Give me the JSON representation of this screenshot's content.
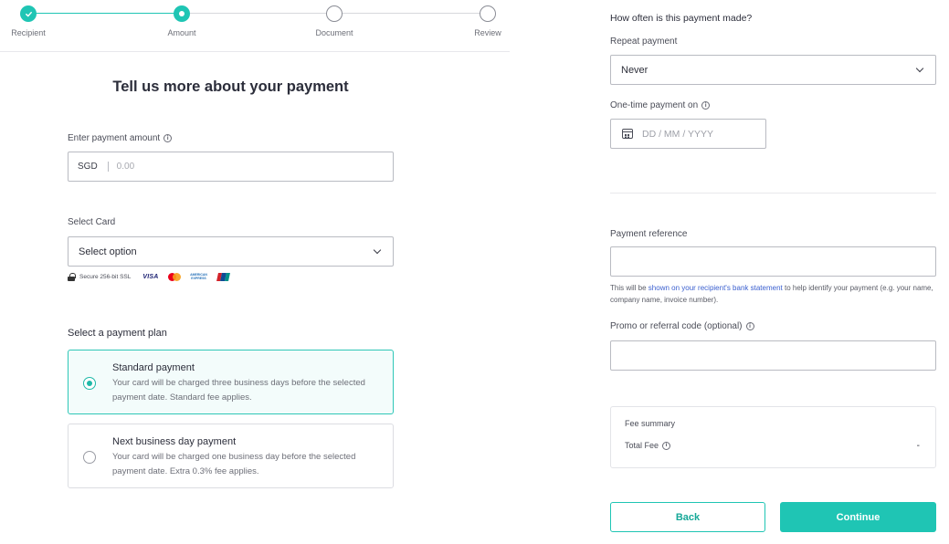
{
  "stepper": {
    "steps": [
      {
        "label": "Recipient",
        "state": "done"
      },
      {
        "label": "Amount",
        "state": "current"
      },
      {
        "label": "Document",
        "state": "todo"
      },
      {
        "label": "Review",
        "state": "todo"
      }
    ]
  },
  "colors": {
    "accent": "#1fc5b4",
    "link": "#3a5fcf"
  },
  "form": {
    "title": "Tell us more about your payment",
    "amount_label": "Enter payment amount",
    "currency": "SGD",
    "amount_placeholder": "0.00",
    "card_label": "Select Card",
    "card_value": "Select option",
    "secure_text": "Secure 256-bit SSL",
    "card_brands": [
      "VISA",
      "Mastercard",
      "AMERICAN EXPRESS",
      "UnionPay"
    ],
    "visa_text": "VISA",
    "amex_text": "AMERICAN EXPRESS",
    "plan_label": "Select a payment plan",
    "plans": [
      {
        "name": "Standard payment",
        "desc": "Your card will be charged three business days before the selected payment date. Standard fee applies.",
        "selected": true
      },
      {
        "name": "Next business day payment",
        "desc": "Your card will be charged one business day before the selected payment date. Extra 0.3% fee applies.",
        "selected": false
      }
    ]
  },
  "schedule": {
    "title": "How often is this payment made?",
    "repeat_label": "Repeat payment",
    "repeat_value": "Never",
    "date_label": "One-time payment on",
    "date_placeholder": "DD / MM / YYYY"
  },
  "reference": {
    "label": "Payment reference",
    "value": "",
    "helper_before": "This will be ",
    "helper_link": "shown on your recipient's bank statement",
    "helper_after": " to help identify your payment (e.g. your name, company name, invoice number)."
  },
  "promo": {
    "label": "Promo or referral code (optional)",
    "value": ""
  },
  "fees": {
    "title": "Fee summary",
    "total_label": "Total Fee",
    "total_value": "-"
  },
  "actions": {
    "back": "Back",
    "continue": "Continue"
  }
}
